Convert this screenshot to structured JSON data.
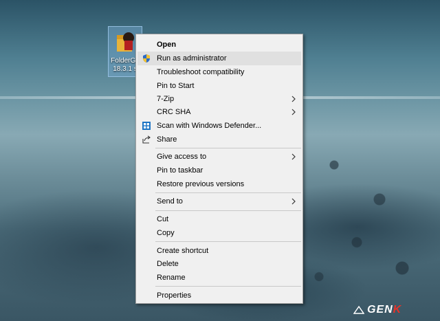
{
  "desktop": {
    "file_caption_line1": "FolderGu",
    "file_caption_line2": "18.3.1 s"
  },
  "context_menu": {
    "open": "Open",
    "run_as_admin": "Run as administrator",
    "troubleshoot": "Troubleshoot compatibility",
    "pin_to_start": "Pin to Start",
    "seven_zip": "7-Zip",
    "crc_sha": "CRC SHA",
    "scan_defender": "Scan with Windows Defender...",
    "share": "Share",
    "give_access": "Give access to",
    "pin_taskbar": "Pin to taskbar",
    "restore_versions": "Restore previous versions",
    "send_to": "Send to",
    "cut": "Cut",
    "copy": "Copy",
    "create_shortcut": "Create shortcut",
    "delete": "Delete",
    "rename": "Rename",
    "properties": "Properties"
  },
  "watermark": {
    "brand_main": "GEN",
    "brand_accent": "K"
  },
  "icons": [
    "shield-icon",
    "defender-icon",
    "share-icon",
    "chevron-right-icon",
    "folder-icon"
  ],
  "colors": {
    "menu_bg": "#f0f0f0",
    "hover_bg": "#e0e0e0",
    "accent_red": "#e5332a"
  }
}
